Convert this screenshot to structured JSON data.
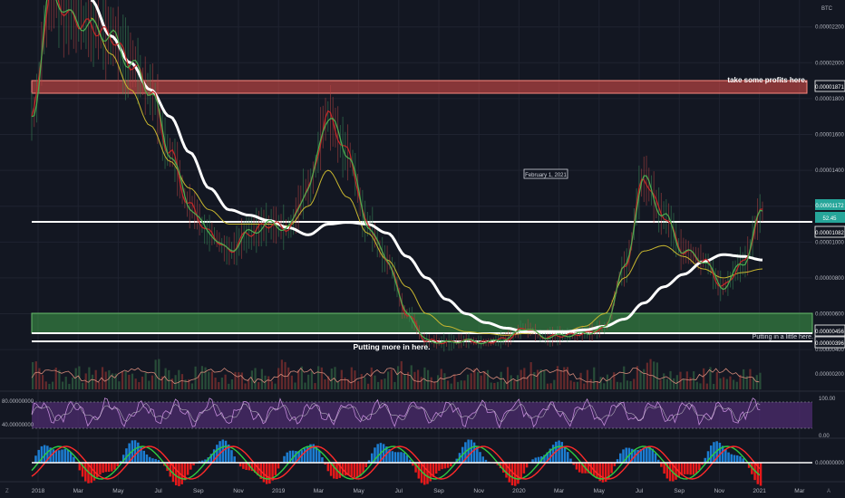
{
  "symbol": "BTC",
  "colors": {
    "background": "#131722",
    "grid": "#1f2330",
    "red_zone": "#e8514a",
    "green_zone": "#3fa14a",
    "level_line": "#ffffff",
    "ma_slow": "#ffffff",
    "ma_fast": "#c8b62f",
    "price_up": "#3a8a5a",
    "price_down": "#b24343",
    "volume": "#7a2e2e",
    "rsi": "#c28ad9",
    "rsi_band": "#4a2a6a",
    "stoch_blue": "#1e88e5",
    "stoch_red": "#ff1a1a",
    "current_price_bg": "#26a69a"
  },
  "annotations": {
    "take_profits": "take some profits here.",
    "putting_more": "Putting more in here.",
    "putting_little": "Putting in a little here.",
    "date_box": "February 1, 2021"
  },
  "price_axis": {
    "labels": [
      "0.00002200",
      "0.00002000",
      "0.00001800",
      "0.00001600",
      "0.00001400",
      "0.00001200",
      "0.00001000",
      "0.00000800",
      "0.00000600",
      "0.00000400"
    ],
    "tags": {
      "take_profit_level": "0.00001871",
      "current_price": "0.00001172",
      "rsi_value": "52.45",
      "resistance_level": "0.00001082",
      "support_level": "0.00000456",
      "buy_level": "0.00000396"
    }
  },
  "volume_axis": {
    "label": "0.00000200"
  },
  "rsi_axis": {
    "left_top": "80.00000000",
    "left_bottom": "40.00000000",
    "right_top": "100.00",
    "right_bottom": "0.00"
  },
  "stoch_axis": {
    "label": "0.00000000"
  },
  "time_axis": {
    "labels": [
      "2018",
      "Mar",
      "May",
      "Jul",
      "Sep",
      "Nov",
      "2019",
      "Mar",
      "May",
      "Jul",
      "Sep",
      "Nov",
      "2020",
      "Mar",
      "May",
      "Jul",
      "Sep",
      "Nov",
      "2021",
      "Mar"
    ],
    "left_icon": "Z",
    "right_icon": "A"
  },
  "chart_data": {
    "type": "line",
    "title": "",
    "xlabel": "",
    "ylabel": "",
    "ylim": [
      3.4e-06,
      2.35e-05
    ],
    "x_range": [
      "2018-01",
      "2021-04"
    ],
    "x": [
      "2018-01",
      "2018-02",
      "2018-03",
      "2018-04",
      "2018-05",
      "2018-06",
      "2018-07",
      "2018-08",
      "2018-09",
      "2018-10",
      "2018-11",
      "2018-12",
      "2019-01",
      "2019-02",
      "2019-03",
      "2019-04",
      "2019-05",
      "2019-06",
      "2019-07",
      "2019-08",
      "2019-09",
      "2019-10",
      "2019-11",
      "2019-12",
      "2020-01",
      "2020-02",
      "2020-03",
      "2020-04",
      "2020-05",
      "2020-06",
      "2020-07",
      "2020-08",
      "2020-09",
      "2020-10",
      "2020-11",
      "2020-12",
      "2021-01",
      "2021-02"
    ],
    "series": [
      {
        "values": [
          1.7e-05,
          2.4e-05,
          2.25e-05,
          2.2e-05,
          2.15e-05,
          2e-05,
          1.85e-05,
          1.5e-05,
          1.2e-05,
          1.05e-05,
          9.5e-06,
          1.05e-05,
          1.1e-05,
          1.08e-05,
          1.3e-05,
          1.7e-05,
          1.5e-05,
          1.1e-05,
          9e-06,
          6e-06,
          4.5e-06,
          4.4e-06,
          4.5e-06,
          4.4e-06,
          4.6e-06,
          5.2e-06,
          4.7e-06,
          4.8e-06,
          4.9e-06,
          5.2e-06,
          8.5e-06,
          1.35e-05,
          1.15e-05,
          9.5e-06,
          9e-06,
          7.5e-06,
          8.8e-06,
          1.17e-05
        ]
      },
      {
        "values": [
          null,
          null,
          null,
          2.35e-05,
          2.15e-05,
          2e-05,
          1.85e-05,
          1.7e-05,
          1.5e-05,
          1.3e-05,
          1.18e-05,
          1.15e-05,
          1.12e-05,
          1.08e-05,
          1.04e-05,
          1.1e-05,
          1.11e-05,
          1.1e-05,
          1.05e-05,
          9.2e-06,
          8e-06,
          6.8e-06,
          6e-06,
          5.5e-06,
          5.2e-06,
          5e-06,
          5e-06,
          5e-06,
          5.1e-06,
          5.3e-06,
          5.7e-06,
          6.6e-06,
          7.5e-06,
          8.2e-06,
          8.9e-06,
          9.3e-06,
          9.2e-06,
          9e-06
        ]
      },
      {
        "values": [
          null,
          null,
          null,
          2.25e-05,
          2.05e-05,
          1.85e-05,
          1.65e-05,
          1.45e-05,
          1.3e-05,
          1.18e-05,
          1.1e-05,
          1.1e-05,
          1.1e-05,
          1.09e-05,
          1.2e-05,
          1.4e-05,
          1.25e-05,
          1.05e-05,
          9e-06,
          7.5e-06,
          6e-06,
          5.3e-06,
          5e-06,
          4.9e-06,
          4.8e-06,
          4.9e-06,
          5e-06,
          5e-06,
          5.3e-06,
          6e-06,
          8e-06,
          9.5e-06,
          9.8e-06,
          9.2e-06,
          8.5e-06,
          8e-06,
          8.3e-06,
          8.5e-06
        ]
      }
    ],
    "zones": [
      {
        "from": 1.83e-05,
        "to": 1.88e-05
      },
      {
        "from": 5e-06,
        "to": 6e-06
      }
    ],
    "levels": [
      1.08e-05,
      4.6e-06,
      4e-06
    ],
    "rsi_ylim": [
      0,
      100
    ],
    "rsi_band": [
      40,
      80
    ],
    "rsi_last": 52.45
  }
}
